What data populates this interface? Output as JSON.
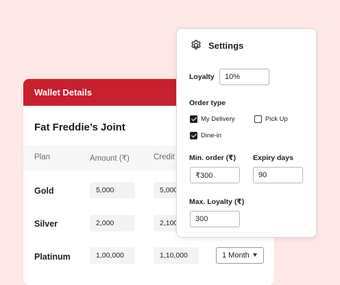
{
  "wallet": {
    "header": "Wallet Details",
    "restaurant": "Fat Freddie’s Joint",
    "columns": [
      "Plan",
      "Amount (₹)",
      "Credit"
    ],
    "rows": [
      {
        "plan": "Gold",
        "amount": "5,000",
        "credit": "5,000"
      },
      {
        "plan": "Silver",
        "amount": "2,000",
        "credit": "2,100"
      },
      {
        "plan": "Platinum",
        "amount": "1,00,000",
        "credit": "1,10,000",
        "validity": "1 Month"
      }
    ]
  },
  "settings": {
    "title": "Settings",
    "loyalty_label": "Loyalty",
    "loyalty_value": "10%",
    "order_type_label": "Order type",
    "options": [
      {
        "label": "My Delivery",
        "checked": true
      },
      {
        "label": "Pick Up",
        "checked": false
      },
      {
        "label": "Dine-in",
        "checked": true
      }
    ],
    "min_order_label": "Min. order (₹)",
    "min_order_value": "₹300",
    "expiry_label": "Expiry days",
    "expiry_value": "90",
    "max_loyalty_label": "Max. Loyalty (₹)",
    "max_loyalty_value": "300"
  },
  "colors": {
    "accent": "#c8202f",
    "background": "#fde7e7"
  }
}
